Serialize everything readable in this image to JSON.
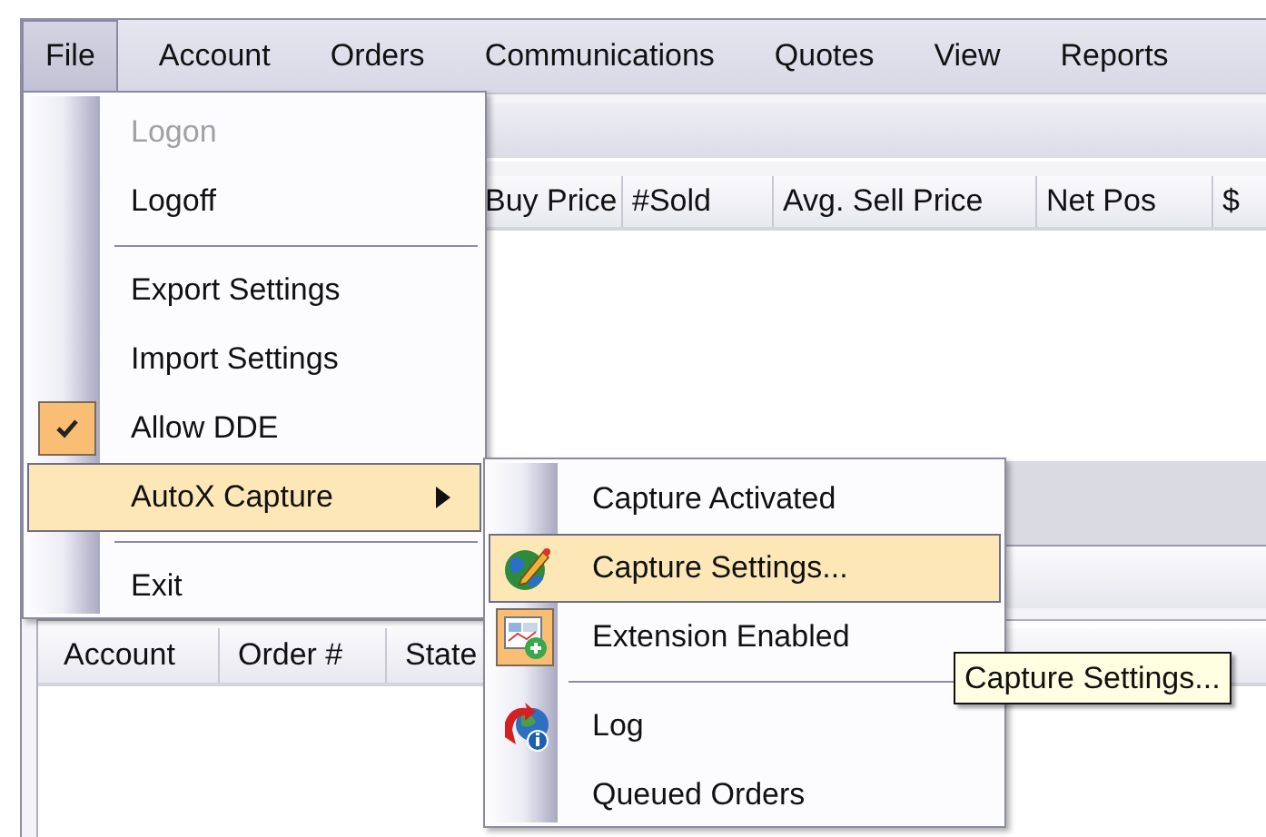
{
  "menubar": [
    {
      "label": "File",
      "selected": true
    },
    {
      "label": "Account",
      "selected": false
    },
    {
      "label": "Orders",
      "selected": false
    },
    {
      "label": "Communications",
      "selected": false
    },
    {
      "label": "Quotes",
      "selected": false
    },
    {
      "label": "View",
      "selected": false
    },
    {
      "label": "Reports",
      "selected": false
    }
  ],
  "positions_grid": {
    "columns": [
      "Buy Price",
      "#Sold",
      "Avg. Sell Price",
      "Net Pos",
      "$"
    ]
  },
  "orders_grid": {
    "columns": [
      "Account",
      "Order #",
      "State"
    ]
  },
  "file_menu": {
    "items": [
      {
        "kind": "item",
        "label": "Logon",
        "disabled": true,
        "checked": false,
        "selected": false
      },
      {
        "kind": "item",
        "label": "Logoff",
        "disabled": false,
        "checked": false,
        "selected": false
      },
      {
        "kind": "separator"
      },
      {
        "kind": "item",
        "label": "Export Settings",
        "disabled": false,
        "checked": false,
        "selected": false
      },
      {
        "kind": "item",
        "label": "Import Settings",
        "disabled": false,
        "checked": false,
        "selected": false
      },
      {
        "kind": "item",
        "label": "Allow DDE",
        "disabled": false,
        "checked": true,
        "selected": false
      },
      {
        "kind": "submenu",
        "label": "AutoX Capture",
        "disabled": false,
        "checked": false,
        "selected": true
      },
      {
        "kind": "separator"
      },
      {
        "kind": "item",
        "label": "Exit",
        "disabled": false,
        "checked": false,
        "selected": false
      }
    ]
  },
  "autox_submenu": {
    "items": [
      {
        "kind": "item",
        "label": "Capture Activated",
        "disabled": false,
        "checked": false,
        "selected": false
      },
      {
        "kind": "item",
        "label": "Capture Settings...",
        "disabled": false,
        "checked": false,
        "selected": true
      },
      {
        "kind": "item",
        "label": "Extension Enabled",
        "disabled": false,
        "checked": true,
        "selected": false
      },
      {
        "kind": "separator"
      },
      {
        "kind": "item",
        "label": "Log",
        "disabled": false,
        "checked": false,
        "selected": false
      },
      {
        "kind": "item",
        "label": "Queued Orders",
        "disabled": false,
        "checked": false,
        "selected": false
      }
    ]
  },
  "tooltip": {
    "text": "Capture Settings..."
  }
}
